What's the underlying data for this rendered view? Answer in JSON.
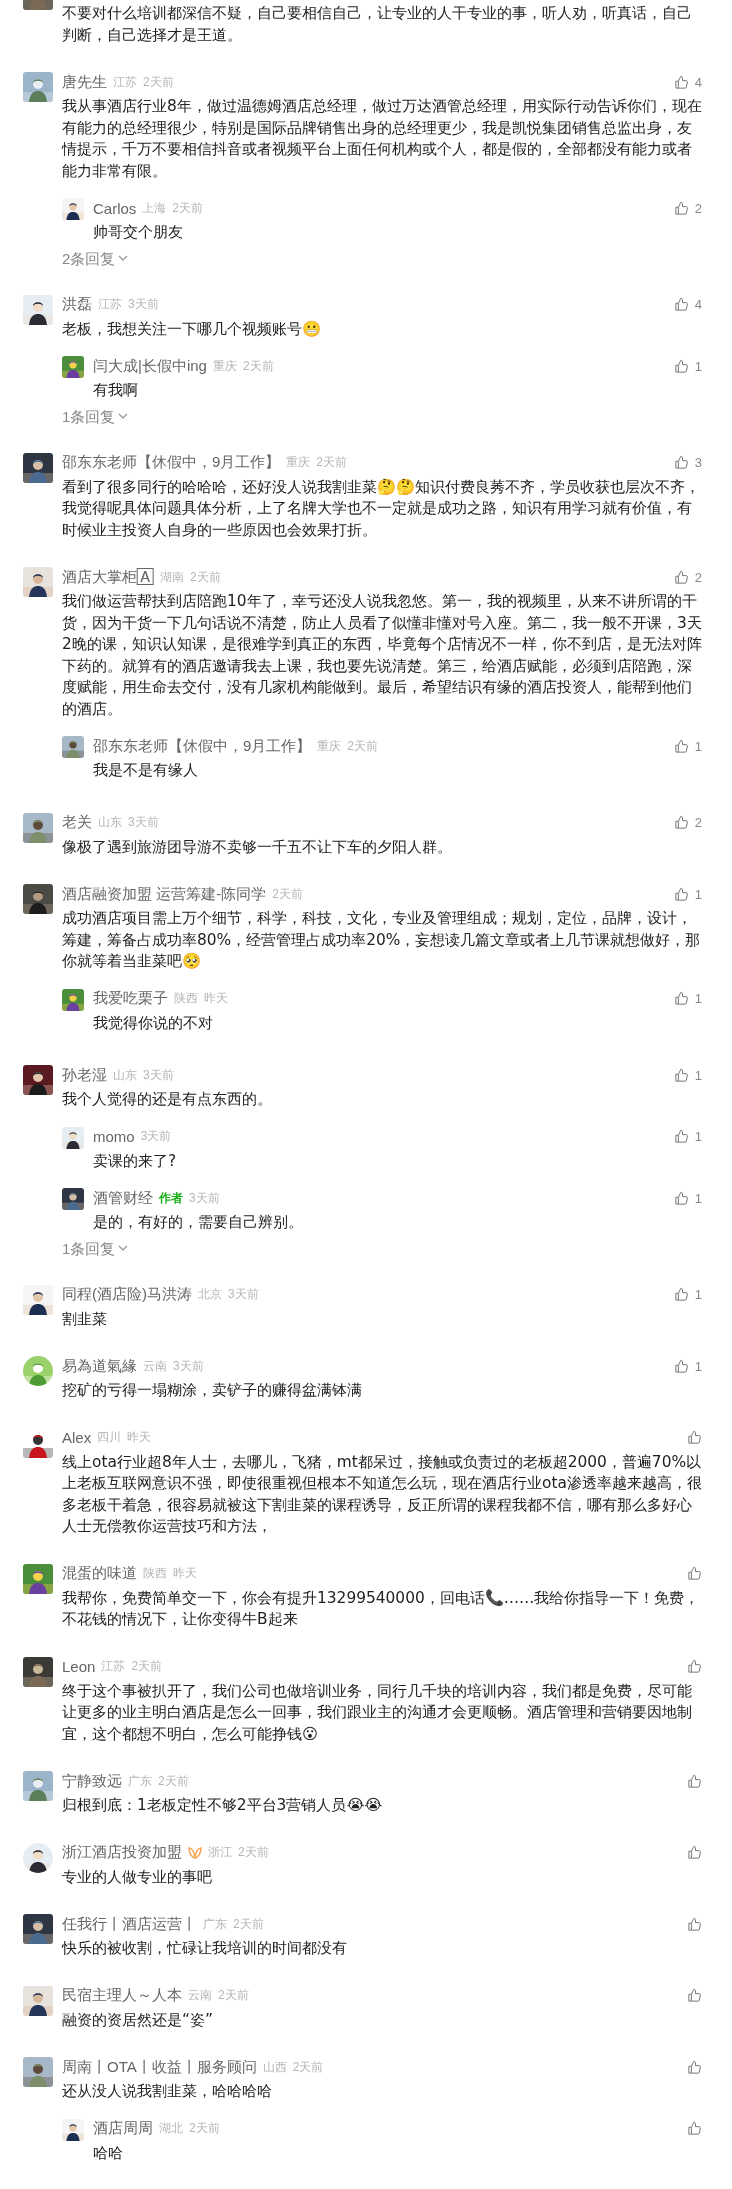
{
  "comments": [
    {
      "text": "不要对什么培训都深信不疑，自己要相信自己，让专业的人干专业的事，听人劝，听真话，自己判断，自己选择才是王道。",
      "cut_header": true,
      "round_avatar": false
    },
    {
      "name": "唐先生",
      "location": "江苏",
      "time": "2天前",
      "likes": "4",
      "round_avatar": false,
      "verified": false,
      "text": "我从事酒店行业8年，做过温德姆酒店总经理，做过万达酒管总经理，用实际行动告诉你们，现在有能力的总经理很少，特别是国际品牌销售出身的总经理更少，我是凯悦集团销售总监出身，友情提示，千万不要相信抖音或者视频平台上面任何机构或个人，都是假的，全部都没有能力或者能力非常有限。",
      "replies": [
        {
          "name": "Carlos",
          "location": "上海",
          "time": "2天前",
          "likes": "2",
          "text": "帅哥交个朋友"
        }
      ],
      "more": "2条回复"
    },
    {
      "name": "洪磊",
      "location": "江苏",
      "time": "3天前",
      "likes": "4",
      "round_avatar": false,
      "verified": false,
      "text": "老板，我想关注一下哪几个视频账号😬",
      "replies": [
        {
          "name": "闫大成|长假中ing",
          "location": "重庆",
          "time": "2天前",
          "likes": "1",
          "text": "有我啊"
        }
      ],
      "more": "1条回复"
    },
    {
      "name": "邵东东老师【休假中，9月工作】",
      "location": "重庆",
      "time": "2天前",
      "likes": "3",
      "round_avatar": false,
      "verified": false,
      "text": "看到了很多同行的哈哈哈，还好没人说我割韭菜🤔🤔知识付费良莠不齐，学员收获也层次不齐，我觉得呢具体问题具体分析，上了名牌大学也不一定就是成功之路，知识有用学习就有价值，有时候业主投资人自身的一些原因也会效果打折。"
    },
    {
      "name": "酒店大掌柜🄰",
      "location": "湖南",
      "time": "2天前",
      "likes": "2",
      "round_avatar": false,
      "verified": false,
      "text": "我们做运营帮扶到店陪跑10年了，幸亏还没人说我忽悠。第一，我的视频里，从来不讲所谓的干货，因为干货一下几句话说不清楚，防止人员看了似懂非懂对号入座。第二，我一般不开课，3天2晚的课，知识认知课，是很难学到真正的东西，毕竟每个店情况不一样，你不到店，是无法对阵下药的。就算有的酒店邀请我去上课，我也要先说清楚。第三，给酒店赋能，必须到店陪跑，深度赋能，用生命去交付，没有几家机构能做到。最后，希望结识有缘的酒店投资人，能帮到他们的酒店。",
      "replies": [
        {
          "name": "邵东东老师【休假中，9月工作】",
          "location": "重庆",
          "time": "2天前",
          "likes": "1",
          "text": "我是不是有缘人"
        }
      ]
    },
    {
      "name": "老关",
      "location": "山东",
      "time": "3天前",
      "likes": "2",
      "round_avatar": false,
      "verified": false,
      "text": "像极了遇到旅游团导游不卖够一千五不让下车的夕阳人群。"
    },
    {
      "name": "酒店融资加盟 运营筹建-陈同学",
      "time": "2天前",
      "likes": "1",
      "round_avatar": false,
      "verified": false,
      "text": "成功酒店项目需上万个细节，科学，科技，文化，专业及管理组成；规划，定位，品牌，设计，筹建，筹备占成功率80%，经营管理占成功率20%，妄想读几篇文章或者上几节课就想做好，那你就等着当韭菜吧🥺",
      "replies": [
        {
          "name": "我爱吃栗子",
          "location": "陕西",
          "time": "昨天",
          "likes": "1",
          "text": "我觉得你说的不对"
        }
      ]
    },
    {
      "name": "孙老湿",
      "location": "山东",
      "time": "3天前",
      "likes": "1",
      "round_avatar": false,
      "verified": false,
      "text": "我个人觉得的还是有点东西的。",
      "replies": [
        {
          "name": "momo",
          "time": "3天前",
          "likes": "1",
          "text": "卖课的来了?"
        },
        {
          "name": "酒管财经",
          "badge": "作者",
          "time": "3天前",
          "likes": "1",
          "text": "是的，有好的，需要自己辨别。"
        }
      ],
      "more": "1条回复"
    },
    {
      "name": "同程(酒店险)马洪涛",
      "location": "北京",
      "time": "3天前",
      "likes": "1",
      "round_avatar": false,
      "verified": false,
      "text": "割韭菜"
    },
    {
      "name": "易為道氣緣",
      "location": "云南",
      "time": "3天前",
      "likes": "1",
      "round_avatar": true,
      "verified": false,
      "text": "挖矿的亏得一塌糊涂，卖铲子的赚得盆满钵满"
    },
    {
      "name": "Alex",
      "location": "四川",
      "time": "昨天",
      "round_avatar": false,
      "verified": false,
      "text": "线上ota行业超8年人士，去哪儿，飞猪，mt都呆过，接触或负责过的老板超2000，普遍70%以上老板互联网意识不强，即使很重视但根本不知道怎么玩，现在酒店行业ota渗透率越来越高，很多老板干着急，很容易就被这下割韭菜的课程诱导，反正所谓的课程我都不信，哪有那么多好心人士无偿教你运营技巧和方法，"
    },
    {
      "name": "混蛋的味道",
      "location": "陕西",
      "time": "昨天",
      "round_avatar": false,
      "verified": false,
      "text": "我帮你，免费简单交一下，你会有提升13299540000，回电话📞……我给你指导一下！免费，不花钱的情况下，让你变得牛B起来"
    },
    {
      "name": "Leon",
      "location": "江苏",
      "time": "2天前",
      "round_avatar": false,
      "verified": false,
      "text": "终于这个事被扒开了，我们公司也做培训业务，同行几千块的培训内容，我们都是免费，尽可能让更多的业主明白酒店是怎么一回事，我们跟业主的沟通才会更顺畅。酒店管理和营销要因地制宜，这个都想不明白，怎么可能挣钱😮"
    },
    {
      "name": "宁静致远",
      "location": "广东",
      "time": "2天前",
      "round_avatar": false,
      "verified": false,
      "text": "归根到底：1老板定性不够2平台3营销人员😭😭"
    },
    {
      "name": "浙江酒店投资加盟",
      "location": "浙江",
      "time": "2天前",
      "round_avatar": true,
      "verified": true,
      "text": "专业的人做专业的事吧"
    },
    {
      "name": "任我行丨酒店运营丨",
      "location": "广东",
      "time": "2天前",
      "round_avatar": false,
      "verified": false,
      "text": "快乐的被收割，忙碌让我培训的时间都没有"
    },
    {
      "name": "民宿主理人～人本",
      "location": "云南",
      "time": "2天前",
      "round_avatar": false,
      "verified": false,
      "text": "融资的资居然还是“姿”"
    },
    {
      "name": "周南丨OTA丨收益丨服务顾问",
      "location": "山西",
      "time": "2天前",
      "round_avatar": false,
      "verified": false,
      "text": "还从没人说我割韭菜，哈哈哈哈",
      "replies": [
        {
          "name": "酒店周周",
          "location": "湖北",
          "time": "2天前",
          "text": "哈哈"
        }
      ]
    }
  ]
}
